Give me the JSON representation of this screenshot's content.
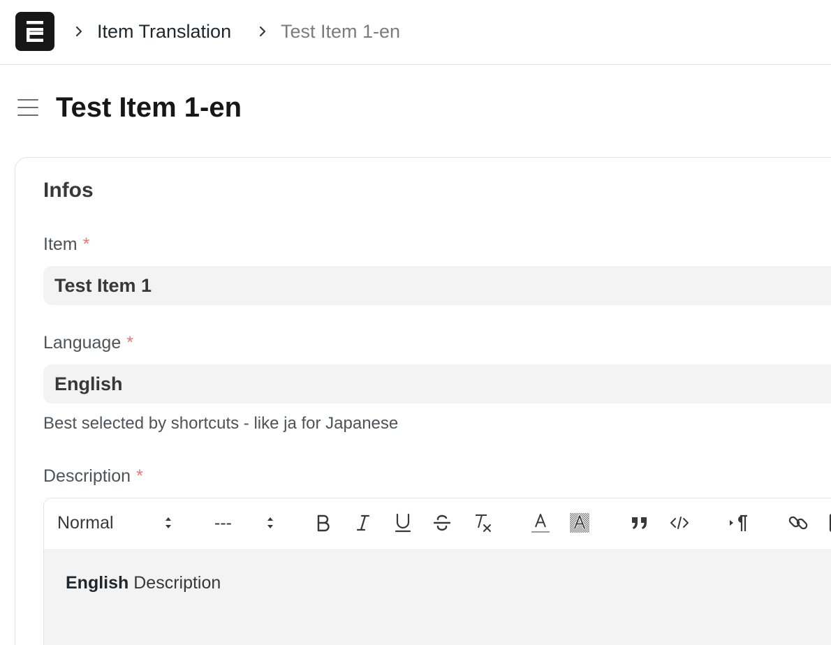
{
  "navbar": {
    "breadcrumbs": [
      {
        "label": "Item Translation"
      },
      {
        "label": "Test Item 1-en"
      }
    ],
    "logo_icon": "frappe-logo-icon"
  },
  "page": {
    "title": "Test Item 1-en",
    "menu_icon": "hamburger-icon"
  },
  "form": {
    "section_title": "Infos",
    "fields": {
      "item": {
        "label": "Item",
        "required_mark": "*",
        "value": "Test Item 1"
      },
      "language": {
        "label": "Language",
        "required_mark": "*",
        "value": "English",
        "help": "Best selected by shortcuts - like ja for Japanese"
      },
      "description": {
        "label": "Description",
        "required_mark": "*"
      }
    },
    "editor": {
      "toolbar": {
        "header_select": "Normal",
        "font_select": "---",
        "buttons": [
          "bold-icon",
          "italic-icon",
          "underline-icon",
          "strikethrough-icon",
          "clear-format-icon",
          "text-color-icon",
          "background-color-icon",
          "blockquote-icon",
          "code-block-icon",
          "text-direction-icon",
          "link-icon"
        ]
      },
      "content": {
        "bold": "English",
        "text": "Description"
      }
    }
  },
  "colors": {
    "required": "#e07b7b",
    "input_bg": "#f3f3f3",
    "logo_bg": "#171717"
  }
}
